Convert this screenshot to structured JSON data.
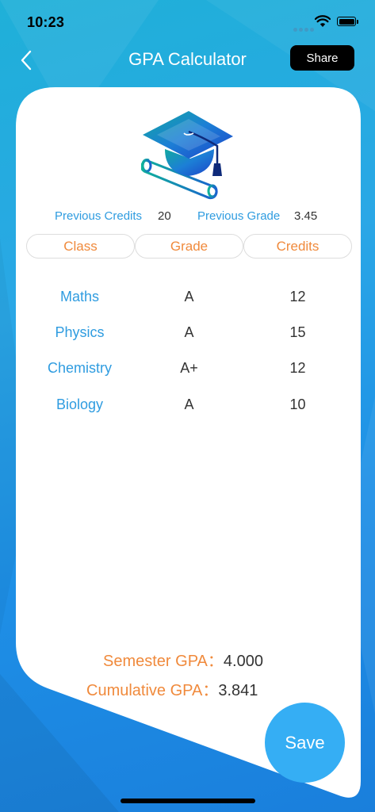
{
  "status_bar": {
    "time": "10:23"
  },
  "nav": {
    "title": "GPA Calculator",
    "share_label": "Share"
  },
  "previous": {
    "credits_label": "Previous Credits",
    "credits_value": "20",
    "grade_label": "Previous Grade",
    "grade_value": "3.45"
  },
  "table": {
    "headers": [
      "Class",
      "Grade",
      "Credits"
    ],
    "rows": [
      {
        "class": "Maths",
        "grade": "A",
        "credits": "12"
      },
      {
        "class": "Physics",
        "grade": "A",
        "credits": "15"
      },
      {
        "class": "Chemistry",
        "grade": "A+",
        "credits": "12"
      },
      {
        "class": "Biology",
        "grade": "A",
        "credits": "10"
      }
    ]
  },
  "results": {
    "semester_label": "Semester GPA：",
    "semester_value": "4.000",
    "cumulative_label": "Cumulative GPA：",
    "cumulative_value": "3.841"
  },
  "save_label": "Save",
  "colors": {
    "accent_blue": "#2f9ce0",
    "accent_orange": "#f08a3c",
    "save_button": "#35aef4",
    "background": "#1e8fe6"
  },
  "icons": {
    "back": "chevron-left-icon",
    "graduation": "graduation-cap-icon"
  }
}
